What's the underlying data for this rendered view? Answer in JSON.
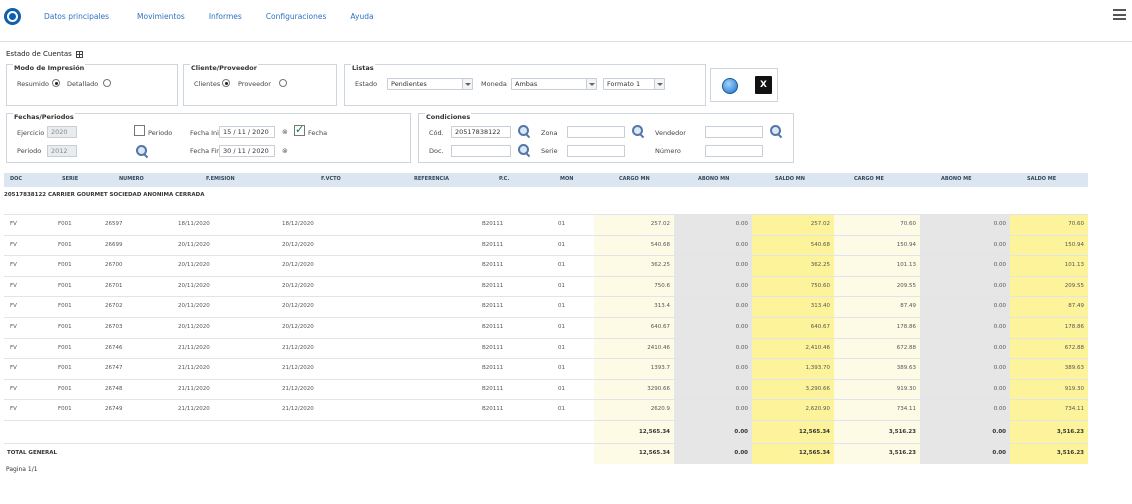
{
  "nav": {
    "items": [
      "Datos principales",
      "Movimientos",
      "Informes",
      "Configuraciones",
      "Ayuda"
    ]
  },
  "page": {
    "title": "Estado de Cuentas"
  },
  "modo": {
    "legend": "Modo de Impresión",
    "resumido": "Resumido",
    "detallado": "Detallado",
    "selected": "Resumido"
  },
  "cliente": {
    "legend": "Cliente/Proveedor",
    "clientes": "Clientes",
    "proveedor": "Proveedor",
    "selected": "Clientes"
  },
  "listas": {
    "legend": "Listas",
    "estado_label": "Estado",
    "estado_value": "Pendientes",
    "moneda_label": "Moneda",
    "moneda_value": "Ambas",
    "formato_value": "Formato 1"
  },
  "fechas": {
    "legend": "Fechas/Periodos",
    "ejercicio_label": "Ejercicio",
    "ejercicio_value": "2020",
    "periodo_label": "Periodo",
    "periodo_value": "2012",
    "periodo_check_label": "Periodo",
    "fecha_ini_label": "Fecha Ini",
    "fecha_ini_value": "15 / 11 / 2020",
    "fecha_fin_label": "Fecha Fin",
    "fecha_fin_value": "30 / 11 / 2020",
    "fecha_check_label": "Fecha"
  },
  "condiciones": {
    "legend": "Condiciones",
    "cod_label": "Cód.",
    "cod_value": "20517838122",
    "doc_label": "Doc.",
    "zona_label": "Zona",
    "serie_label": "Serie",
    "vendedor_label": "Vendedor",
    "numero_label": "Número"
  },
  "table": {
    "headers": [
      "DOC",
      "SERIE",
      "NUMERO",
      "F.EMISION",
      "F.VCTO",
      "REFERENCIA",
      "P.C.",
      "MON",
      "CARGO MN",
      "ABONO MN",
      "SALDO MN",
      "CARGO ME",
      "ABONO ME",
      "SALDO ME"
    ],
    "group": "20517838122   CARRIER GOURMET SOCIEDAD ANONIMA CERRADA",
    "rows": [
      [
        "FV",
        "F001",
        "26597",
        "18/11/2020",
        "18/12/2020",
        "",
        "B20111",
        "01",
        "257.02",
        "0.00",
        "257.02",
        "70.60",
        "0.00",
        "70.60"
      ],
      [
        "FV",
        "F001",
        "26699",
        "20/11/2020",
        "20/12/2020",
        "",
        "B20111",
        "01",
        "540.68",
        "0.00",
        "540.68",
        "150.94",
        "0.00",
        "150.94"
      ],
      [
        "FV",
        "F001",
        "26700",
        "20/11/2020",
        "20/12/2020",
        "",
        "B20111",
        "01",
        "362.25",
        "0.00",
        "362.25",
        "101.13",
        "0.00",
        "101.13"
      ],
      [
        "FV",
        "F001",
        "26701",
        "20/11/2020",
        "20/12/2020",
        "",
        "B20111",
        "01",
        "750.6",
        "0.00",
        "750.60",
        "209.55",
        "0.00",
        "209.55"
      ],
      [
        "FV",
        "F001",
        "26702",
        "20/11/2020",
        "20/12/2020",
        "",
        "B20111",
        "01",
        "313.4",
        "0.00",
        "313.40",
        "87.49",
        "0.00",
        "87.49"
      ],
      [
        "FV",
        "F001",
        "26703",
        "20/11/2020",
        "20/12/2020",
        "",
        "B20111",
        "01",
        "640.67",
        "0.00",
        "640.67",
        "178.86",
        "0.00",
        "178.86"
      ],
      [
        "FV",
        "F001",
        "26746",
        "21/11/2020",
        "21/12/2020",
        "",
        "B20111",
        "01",
        "2410.46",
        "0.00",
        "2,410.46",
        "672.88",
        "0.00",
        "672.88"
      ],
      [
        "FV",
        "F001",
        "26747",
        "21/11/2020",
        "21/12/2020",
        "",
        "B20111",
        "01",
        "1393.7",
        "0.00",
        "1,393.70",
        "389.63",
        "0.00",
        "389.63"
      ],
      [
        "FV",
        "F001",
        "26748",
        "21/11/2020",
        "21/12/2020",
        "",
        "B20111",
        "01",
        "3290.66",
        "0.00",
        "3,290.66",
        "919.30",
        "0.00",
        "919.30"
      ],
      [
        "FV",
        "F001",
        "26749",
        "21/11/2020",
        "21/12/2020",
        "",
        "B20111",
        "01",
        "2620.9",
        "0.00",
        "2,620.90",
        "734.11",
        "0.00",
        "734.11"
      ]
    ],
    "subtotal": [
      "12,565.34",
      "0.00",
      "12,565.34",
      "3,516.23",
      "0.00",
      "3,516.23"
    ],
    "total_label": "TOTAL GENERAL",
    "total": [
      "12,565.34",
      "0.00",
      "12,565.34",
      "3,516.23",
      "0.00",
      "3,516.23"
    ]
  },
  "pager": {
    "text": "Pagina 1/1"
  },
  "colors": {
    "nav_link": "#2f72c4",
    "header_bg": "#dbe6f1",
    "cargo_bg": "#fdfbe6",
    "abono_bg": "#e6e6e6",
    "saldo_bg": "#fdf39a"
  }
}
